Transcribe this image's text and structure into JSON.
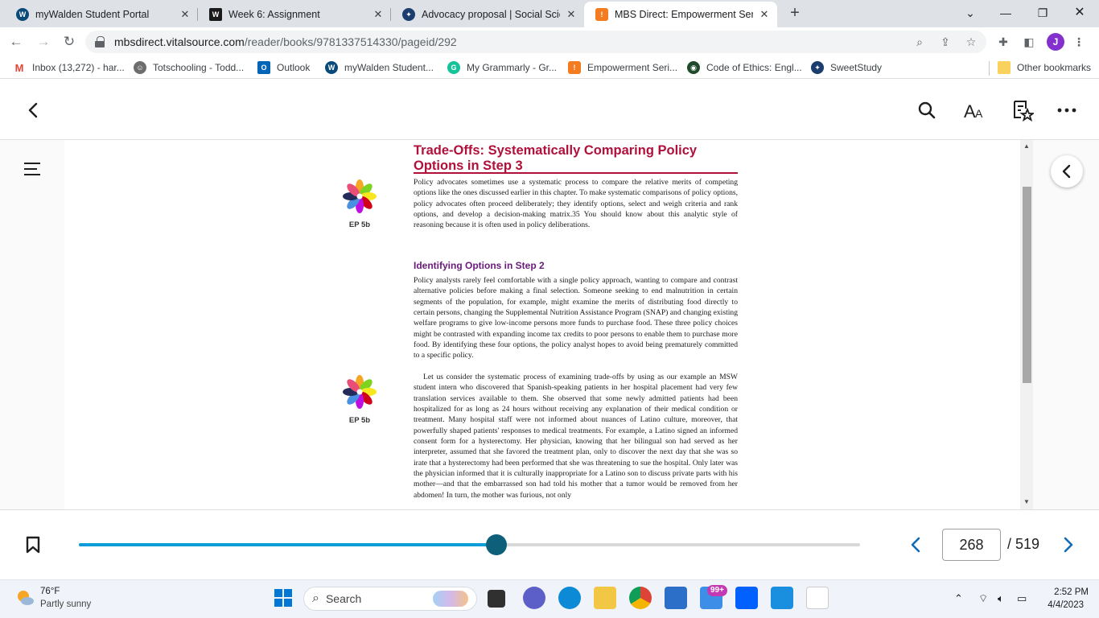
{
  "browser": {
    "tabs": [
      {
        "title": "myWalden Student Portal",
        "icon": "walden-w-icon",
        "color": "#0a4a7a"
      },
      {
        "title": "Week 6: Assignment",
        "icon": "walden-w-square-icon",
        "color": "#1a1a1a"
      },
      {
        "title": "Advocacy proposal | Social Scienc",
        "icon": "sweetstudy-icon",
        "color": "#1b3e6e"
      },
      {
        "title": "MBS Direct: Empowerment Series",
        "icon": "mbs-bag-icon",
        "color": "#f47b20"
      }
    ],
    "url_host": "mbsdirect.vitalsource.com",
    "url_path": "/reader/books/9781337514330/pageid/292",
    "profile_initial": "J",
    "bookmarks": [
      {
        "label": "Inbox (13,272) - har...",
        "icon": "gmail-icon"
      },
      {
        "label": "Totschooling - Todd...",
        "icon": "totschooling-icon"
      },
      {
        "label": "Outlook",
        "icon": "outlook-icon"
      },
      {
        "label": "myWalden Student...",
        "icon": "walden-w-icon"
      },
      {
        "label": "My Grammarly - Gr...",
        "icon": "grammarly-icon"
      },
      {
        "label": "Empowerment Seri...",
        "icon": "mbs-bag-icon"
      },
      {
        "label": "Code of Ethics: Engl...",
        "icon": "nasw-icon"
      },
      {
        "label": "SweetStudy",
        "icon": "sweetstudy-icon"
      }
    ],
    "other_bookmarks": "Other bookmarks"
  },
  "reader": {
    "heading": "Trade-Offs: Systematically Comparing Policy Options in Step 3",
    "intro_para": "Policy advocates sometimes use a systematic process to compare the relative merits of competing options like the ones discussed earlier in this chapter. To make systematic comparisons of policy options, policy advocates often proceed deliberately; they identify options, select and weigh criteria and rank options, and develop a decision-making matrix.35 You should know about this analytic style of reasoning because it is often used in policy deliberations.",
    "subheading": "Identifying Options in Step 2",
    "para2": "Policy analysts rarely feel comfortable with a single policy approach, wanting to compare and contrast alternative policies before making a final selection. Someone seeking to end malnutrition in certain segments of the population, for example, might examine the merits of distributing food directly to certain persons, changing the Supplemental Nutrition Assistance Program (SNAP) and changing existing welfare programs to give low-income persons more funds to purchase food. These three policy choices might be contrasted with expanding income tax credits to poor persons to enable them to purchase more food. By identifying these four options, the policy analyst hopes to avoid being prematurely committed to a specific policy.",
    "para3": "Let us consider the systematic process of examining trade-offs by using as our example an MSW student intern who discovered that Spanish-speaking patients in her hospital placement had very few translation services available to them. She observed that some newly admitted patients had been hospitalized for as long as 24 hours without receiving any explanation of their medical condition or treatment. Many hospital staff were not informed about nuances of Latino culture, moreover, that powerfully shaped patients' responses to medical treatments. For example, a Latino signed an informed consent form for a hysterectomy. Her physician, knowing that her bilingual son had served as her interpreter, assumed that she favored the treatment plan, only to discover the next day that she was so irate that a hysterectomy had been performed that she was threatening to sue the hospital. Only later was the physician informed that it is culturally inappropriate for a Latino son to discuss private parts with his mother—and that the embarrassed son had told his mother that a tumor would be removed from her abdomen! In turn, the mother was furious, not only",
    "ep_label_1": "EP 5b",
    "ep_label_2": "EP 5b",
    "current_page": "268",
    "total_pages": "/ 519",
    "progress": 0.535
  },
  "taskbar": {
    "temp": "76°F",
    "weather": "Partly sunny",
    "search": "Search",
    "badge": "99+",
    "time": "2:52 PM",
    "date": "4/4/2023"
  },
  "colors": {
    "heading": "#b0103a",
    "subheading": "#6a1a7a",
    "progress_fill": "#0a9dd9",
    "progress_thumb": "#0d5f7a"
  }
}
